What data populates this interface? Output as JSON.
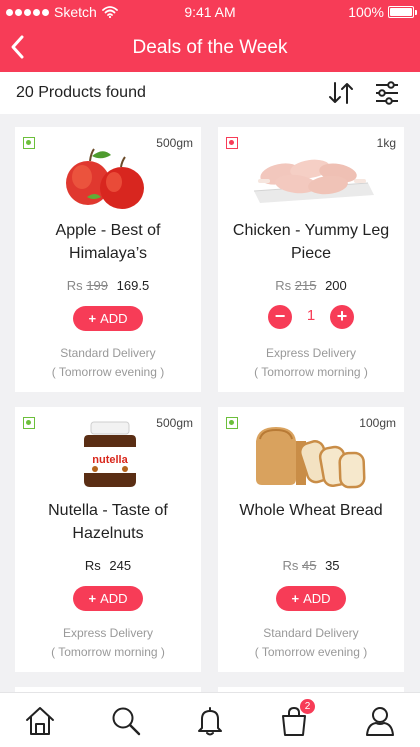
{
  "status_bar": {
    "carrier": "Sketch",
    "time": "9:41 AM",
    "battery": "100%"
  },
  "header": {
    "title": "Deals of the Week",
    "back_icon": "chevron-left-icon"
  },
  "toolbar": {
    "results_text": "20 Products found",
    "sort_icon": "sort-icon",
    "filter_icon": "sliders-icon"
  },
  "products": [
    {
      "name": "Apple - Best of Himalaya’s",
      "weight": "500gm",
      "currency": "Rs",
      "old_price": "199",
      "price": "169.5",
      "action": "ADD",
      "delivery": "Standard Delivery",
      "delivery_time": "( Tomorrow evening )",
      "type": "veg"
    },
    {
      "name": "Chicken - Yummy Leg Piece",
      "weight": "1kg",
      "currency": "Rs",
      "old_price": "215",
      "price": "200",
      "quantity": "1",
      "delivery": "Express Delivery",
      "delivery_time": "( Tomorrow morning )",
      "type": "non-veg"
    },
    {
      "name": "Nutella - Taste of Hazelnuts",
      "weight": "500gm",
      "currency": "Rs",
      "price": "245",
      "action": "ADD",
      "delivery": "Express Delivery",
      "delivery_time": "( Tomorrow morning )",
      "type": "veg",
      "label_text": "nutella"
    },
    {
      "name": "Whole Wheat Bread",
      "weight": "100gm",
      "currency": "Rs",
      "old_price": "45",
      "price": "35",
      "action": "ADD",
      "delivery": "Standard Delivery",
      "delivery_time": "( Tomorrow evening )",
      "type": "veg"
    }
  ],
  "bottom_nav": {
    "items": [
      "home-icon",
      "search-icon",
      "bell-icon",
      "shopping-bag-icon",
      "user-icon"
    ],
    "cart_badge": "2"
  },
  "colors": {
    "accent": "#f73c57",
    "veg": "#6cbf3b",
    "background": "#f1f1f3"
  }
}
